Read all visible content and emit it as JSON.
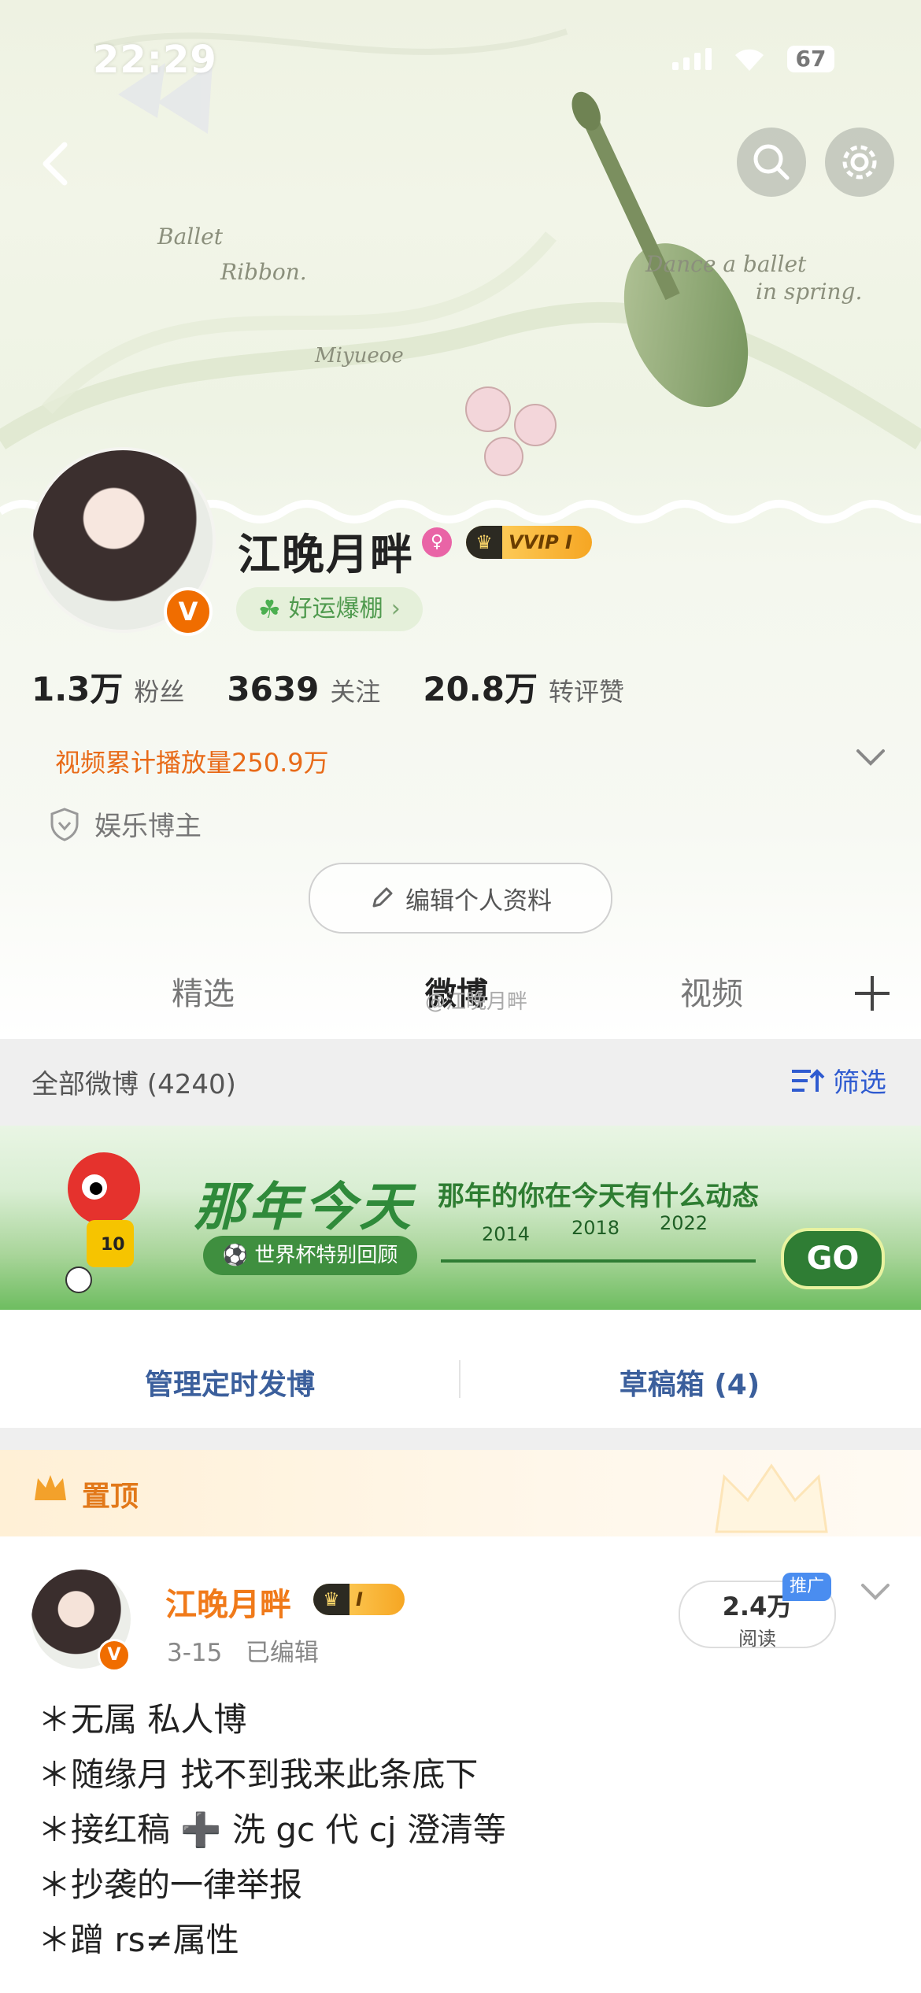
{
  "status_bar": {
    "time": "22:29",
    "battery": "67"
  },
  "profile": {
    "name": "江晚月畔",
    "vip_label": "VVIP I",
    "verified_badge": "V",
    "luck_label": "好运爆棚",
    "stats": [
      {
        "value": "1.3万",
        "label": "粉丝"
      },
      {
        "value": "3639",
        "label": "关注"
      },
      {
        "value": "20.8万",
        "label": "转评赞"
      }
    ],
    "video_plays": "视频累计播放量250.9万",
    "blogger_type": "娱乐博主",
    "edit_button": "编辑个人资料"
  },
  "tabs": [
    {
      "label": "精选"
    },
    {
      "label": "微博"
    },
    {
      "label": "视频"
    }
  ],
  "tab_watermark": "@江晚月畔",
  "filter": {
    "all_label": "全部微博 (4240)",
    "filter_label": "筛选"
  },
  "banner": {
    "title": "那年今天",
    "subtitle": "那年的你在今天有什么动态",
    "tag": "世界杯特别回顾",
    "years": [
      "2014",
      "2018",
      "2022"
    ],
    "go_label": "GO",
    "mascot_number": "10"
  },
  "actions": {
    "scheduled": "管理定时发博",
    "drafts": "草稿箱 (4)"
  },
  "pinned": {
    "label": "置顶"
  },
  "post": {
    "author": "江晚月畔",
    "vip_level": "I",
    "date": "3-15",
    "edited": "已编辑",
    "reads_value": "2.4万",
    "reads_label": "阅读",
    "promo_label": "推广",
    "lines": [
      "＊无属 私人博",
      "＊随缘月 找不到我来此条底下",
      "＊接红稿 ➕ 洗 gc  代 cj 澄清等",
      "＊抄袭的一律举报",
      "＊蹭 rs≠属性"
    ]
  },
  "decor_texts": [
    "Ballet",
    "Ribbon.",
    "Dance a ballet",
    "in spring.",
    "Miyueoe"
  ],
  "colors": {
    "accent_orange": "#f07a1a",
    "link_blue": "#2f5bd0",
    "banner_green": "#2f7d34"
  }
}
